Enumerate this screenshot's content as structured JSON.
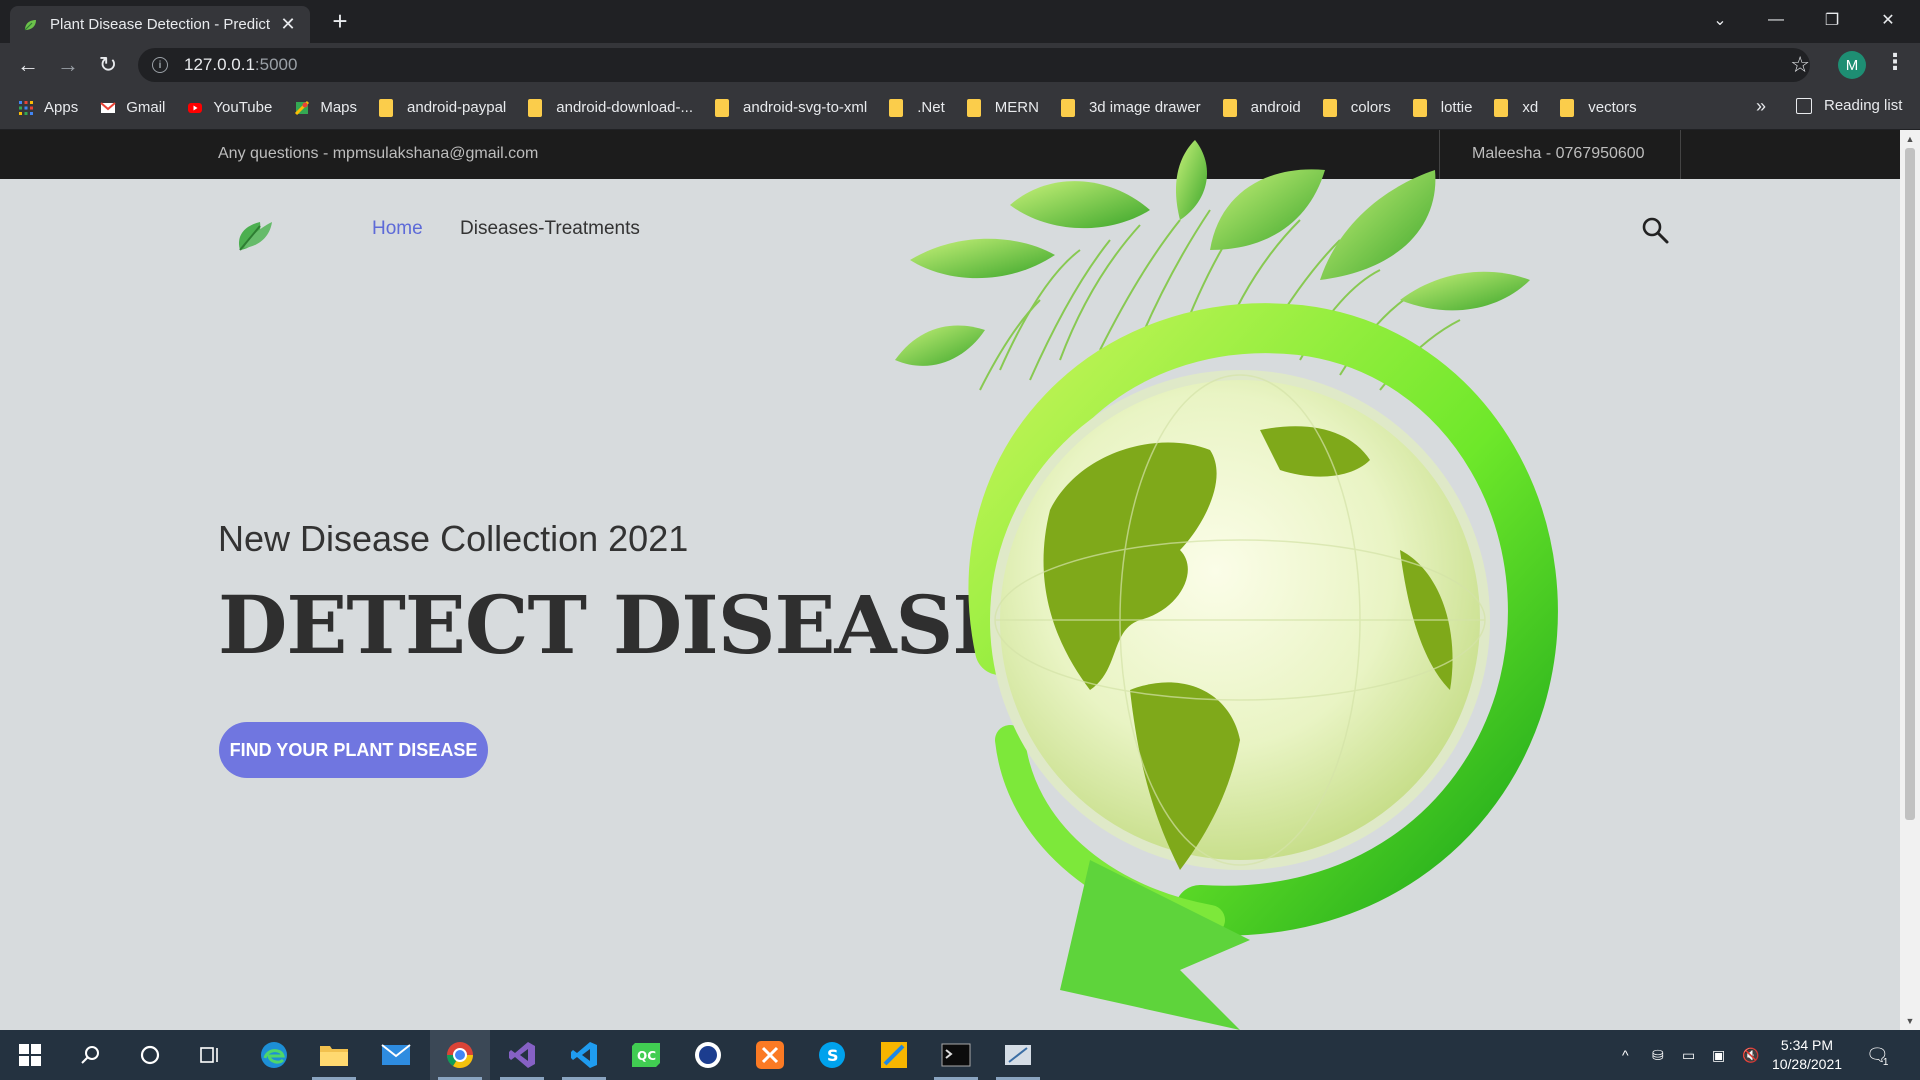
{
  "browser": {
    "tab_title": "Plant Disease Detection - Predict",
    "url_host": "127.0.0.1",
    "url_port": ":5000",
    "profile_initial": "M",
    "bookmarks": [
      "Apps",
      "Gmail",
      "YouTube",
      "Maps",
      "android-paypal",
      "android-download-...",
      "android-svg-to-xml",
      ".Net",
      "MERN",
      "3d image drawer",
      "android",
      "colors",
      "lottie",
      "xd",
      "vectors"
    ],
    "bookmarks_more": "»",
    "reading_list": "Reading list"
  },
  "site": {
    "topbar": {
      "questions": "Any questions - mpmsulakshana@gmail.com",
      "contact": "Maleesha - 0767950600"
    },
    "nav": {
      "home": "Home",
      "diseases": "Diseases-Treatments"
    },
    "hero": {
      "subtitle": "New Disease Collection 2021",
      "title": "DETECT DISEASES",
      "cta": "FIND YOUR PLANT DISEASE"
    },
    "colors": {
      "accent": "#7076e0",
      "nav_active": "#5d6ad8",
      "background": "#d7dbdd"
    }
  },
  "taskbar": {
    "time": "5:34 PM",
    "date": "10/28/2021",
    "notification_count": "1"
  }
}
